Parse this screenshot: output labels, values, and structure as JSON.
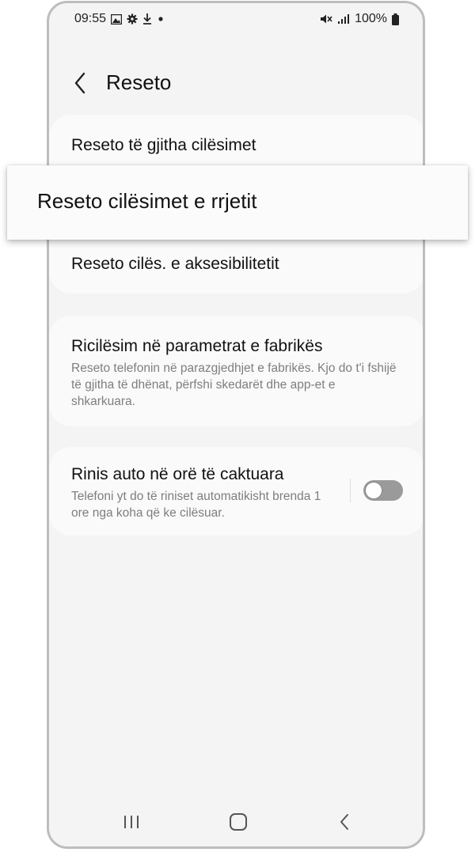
{
  "status_bar": {
    "time": "09:55",
    "battery": "100%",
    "left_icons": [
      "gallery-icon",
      "settings-gear-icon",
      "download-icon",
      "dot-icon"
    ],
    "right_icons": [
      "mute-icon",
      "signal-icon",
      "battery-icon"
    ]
  },
  "header": {
    "back_icon": "chevron-left-icon",
    "title": "Reseto"
  },
  "reset_group": {
    "items": [
      {
        "label": "Reseto të gjitha cilësimet"
      },
      {
        "label": "Reseto cilësimet e rrjetit"
      },
      {
        "label": "Reseto cilës. e aksesibilitetit"
      }
    ]
  },
  "factory_reset": {
    "title": "Ricilësim në parametrat e fabrikës",
    "description": "Reseto telefonin në parazgjedhjet e fabrikës. Kjo do t'i fshijë të gjitha të dhënat, përfshi skedarët dhe app-et e shkarkuara."
  },
  "auto_restart": {
    "title": "Rinis auto në orë të caktuara",
    "description": "Telefoni yt do të riniset automatikisht brenda 1 ore nga koha që ke cilësuar.",
    "toggle_on": false
  },
  "nav_bar": {
    "icons": [
      "recent-apps-icon",
      "home-icon",
      "back-icon"
    ]
  },
  "colors": {
    "screen_background": "#f4f4f4",
    "card_background": "#fafafa",
    "toggle_off": "#9a9a9a"
  }
}
